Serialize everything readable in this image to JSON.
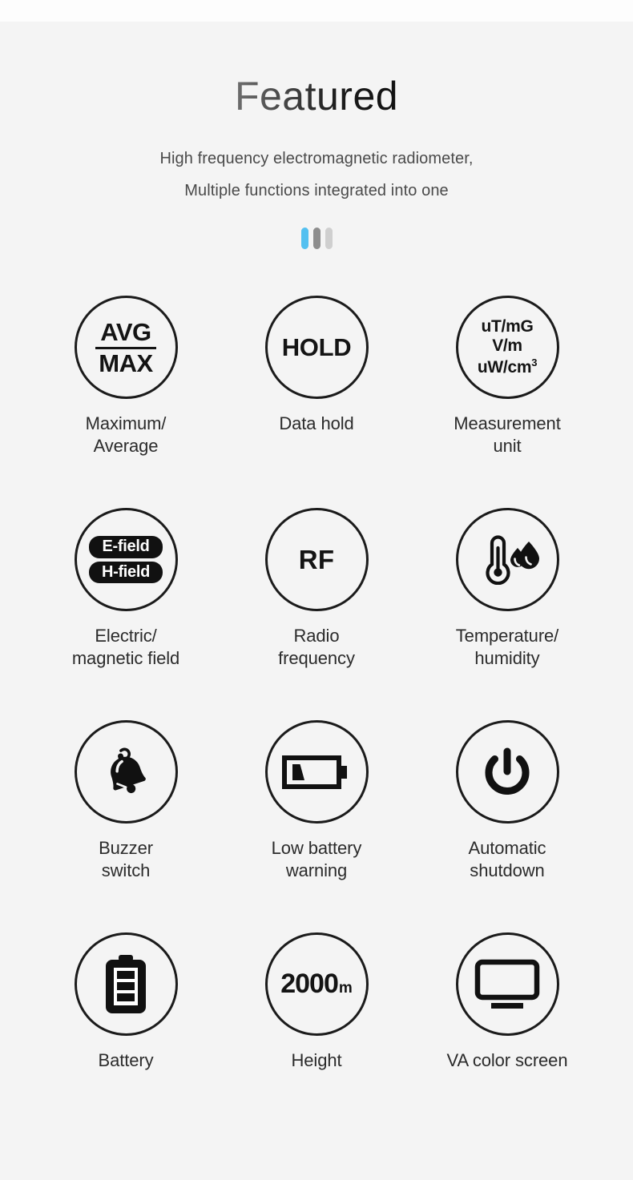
{
  "header": {
    "title": "Featured",
    "subtitle_line1": "High frequency electromagnetic radiometer,",
    "subtitle_line2": "Multiple functions integrated into one"
  },
  "accent_bars": [
    {
      "name": "bar-blue",
      "color": "#53c0f0"
    },
    {
      "name": "bar-dark",
      "color": "#8d8d8d"
    },
    {
      "name": "bar-light",
      "color": "#cfcfcf"
    }
  ],
  "features": [
    {
      "id": "maximum-average",
      "icon": "avg-max-text-icon",
      "icon_text_top": "AVG",
      "icon_text_bottom": "MAX",
      "caption": "Maximum/\nAverage"
    },
    {
      "id": "data-hold",
      "icon": "hold-text-icon",
      "icon_text": "HOLD",
      "caption": "Data hold"
    },
    {
      "id": "measurement-unit",
      "icon": "measurement-unit-text-icon",
      "icon_text_line1": "uT/mG",
      "icon_text_line2": "V/m",
      "icon_text_line3": "uW/cm",
      "icon_text_line3_sup": "3",
      "caption": "Measurement\nunit"
    },
    {
      "id": "electric-magnetic-field",
      "icon": "e-field-h-field-badge-icon",
      "badge_top": "E-field",
      "badge_bottom": "H-field",
      "caption": "Electric/\nmagnetic field"
    },
    {
      "id": "radio-frequency",
      "icon": "rf-text-icon",
      "icon_text": "RF",
      "caption": "Radio\nfrequency"
    },
    {
      "id": "temperature-humidity",
      "icon": "thermometer-humidity-icon",
      "caption": "Temperature/\nhumidity"
    },
    {
      "id": "buzzer-switch",
      "icon": "bell-icon",
      "caption": "Buzzer\nswitch"
    },
    {
      "id": "low-battery-warning",
      "icon": "low-battery-icon",
      "caption": "Low battery\nwarning"
    },
    {
      "id": "automatic-shutdown",
      "icon": "power-icon",
      "caption": "Automatic\nshutdown"
    },
    {
      "id": "battery",
      "icon": "battery-full-icon",
      "caption": "Battery"
    },
    {
      "id": "height",
      "icon": "height-2000m-text-icon",
      "icon_number": "2000",
      "icon_unit": "m",
      "caption": "Height"
    },
    {
      "id": "va-color-screen",
      "icon": "monitor-icon",
      "caption": "VA color screen"
    }
  ],
  "colors": {
    "background": "#f4f4f4",
    "ink": "#1b1b1b",
    "caption": "#2b2b2b",
    "subtitle": "#4a4a4a"
  }
}
